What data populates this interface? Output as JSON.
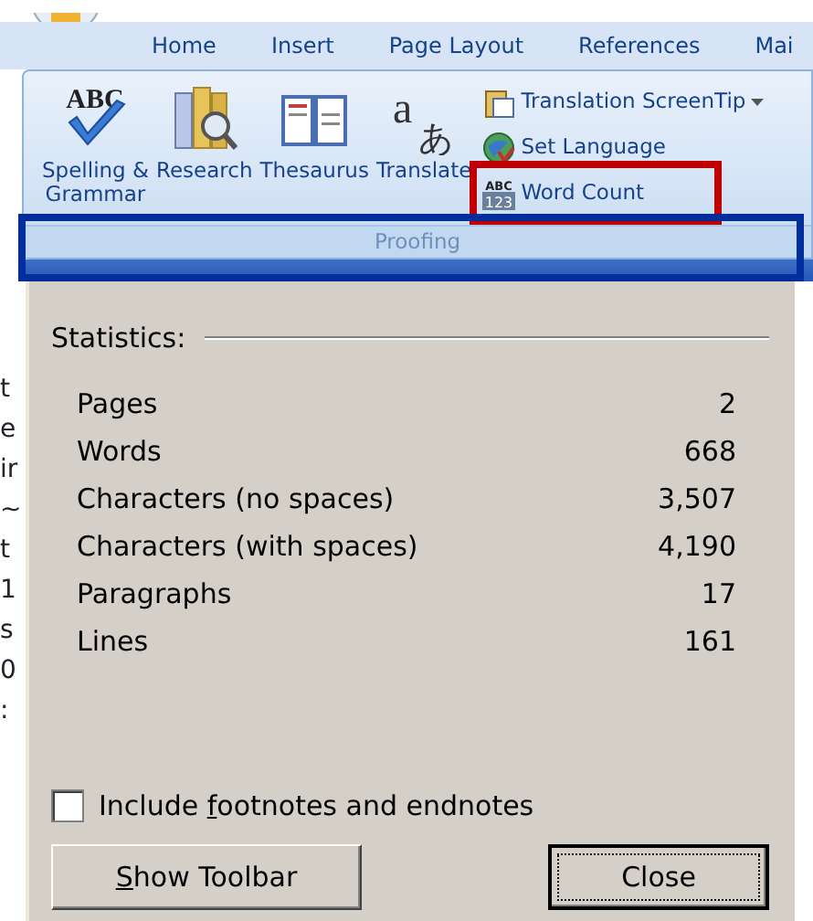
{
  "ribbon": {
    "tabs": [
      {
        "label": "Home",
        "selected": false
      },
      {
        "label": "Insert",
        "selected": false
      },
      {
        "label": "Page Layout",
        "selected": false
      },
      {
        "label": "References",
        "selected": false
      },
      {
        "label": "Mai",
        "selected": false
      }
    ],
    "group": {
      "title": "Proofing",
      "large_buttons": [
        {
          "kind": "spelling",
          "label": "Spelling &",
          "label_2": "Grammar",
          "icon_text": "ABC"
        },
        {
          "kind": "research",
          "label": "Research"
        },
        {
          "kind": "thesaurus",
          "label": "Thesaurus"
        },
        {
          "kind": "translate",
          "label": "Translate",
          "icon_text": "a",
          "icon_text_2": "あ"
        }
      ],
      "small_buttons": [
        {
          "kind": "screentip",
          "label": "Translation ScreenTip",
          "dropdown": true,
          "highlighted": false
        },
        {
          "kind": "language",
          "label": "Set Language",
          "dropdown": false,
          "highlighted": false
        },
        {
          "kind": "wordcount",
          "label": "Word Count",
          "dropdown": false,
          "icon_text": "ABC",
          "icon_text_2": "123",
          "highlighted": true
        }
      ]
    }
  },
  "document_edge": [
    "t",
    "e",
    "ir",
    "~",
    "t",
    "1",
    "s",
    "0",
    ":"
  ],
  "dialog": {
    "section": "Statistics:",
    "stats": [
      {
        "label": "Pages",
        "value": "2"
      },
      {
        "label": "Words",
        "value": "668"
      },
      {
        "label": "Characters (no spaces)",
        "value": "3,507"
      },
      {
        "label": "Characters (with spaces)",
        "value": "4,190"
      },
      {
        "label": "Paragraphs",
        "value": "17"
      },
      {
        "label": "Lines",
        "value": "161"
      }
    ],
    "checkbox": {
      "before": "Include ",
      "key": "f",
      "after": "ootnotes and endnotes",
      "checked": false
    },
    "buttons": [
      {
        "key": "S",
        "after": "how Toolbar",
        "default": false
      },
      {
        "before": "Close",
        "default": true
      }
    ]
  }
}
